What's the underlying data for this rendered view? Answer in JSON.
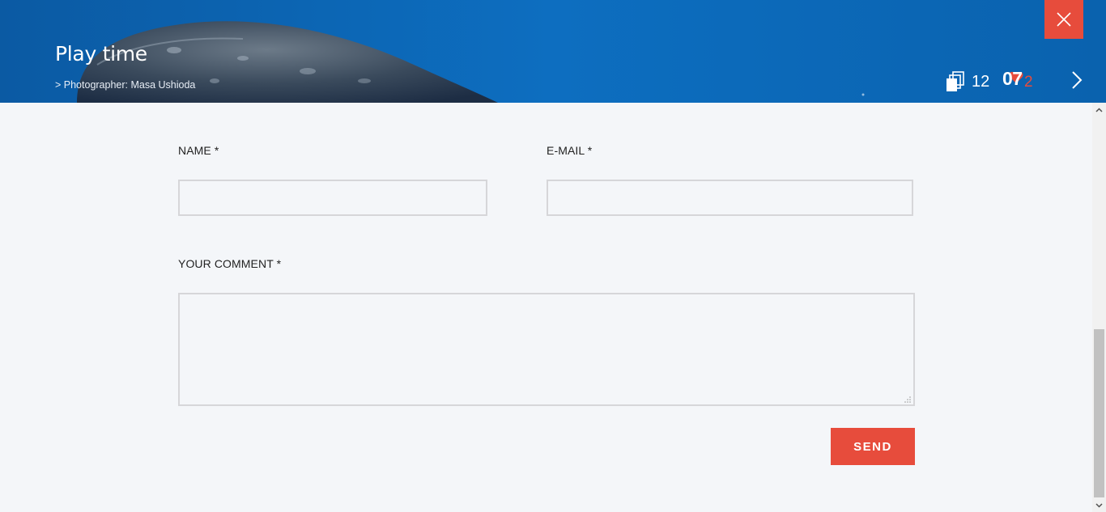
{
  "hero": {
    "title": "Play time",
    "credit": "> Photographer: Masa Ushioda",
    "gallery_count": "12",
    "photo_number": "07",
    "likes": "2",
    "accent_color": "#e74c3c",
    "icons": {
      "close": "close-icon",
      "gallery": "gallery-stack-icon",
      "like": "heart-icon",
      "next": "chevron-right-icon"
    }
  },
  "form": {
    "name_label": "NAME *",
    "email_label": "E-MAIL *",
    "comment_label": "YOUR COMMENT *",
    "name_value": "",
    "email_value": "",
    "comment_value": "",
    "send_label": "SEND"
  },
  "scrollbar": {
    "icons": {
      "up": "chevron-up-icon",
      "down": "chevron-down-icon"
    }
  }
}
